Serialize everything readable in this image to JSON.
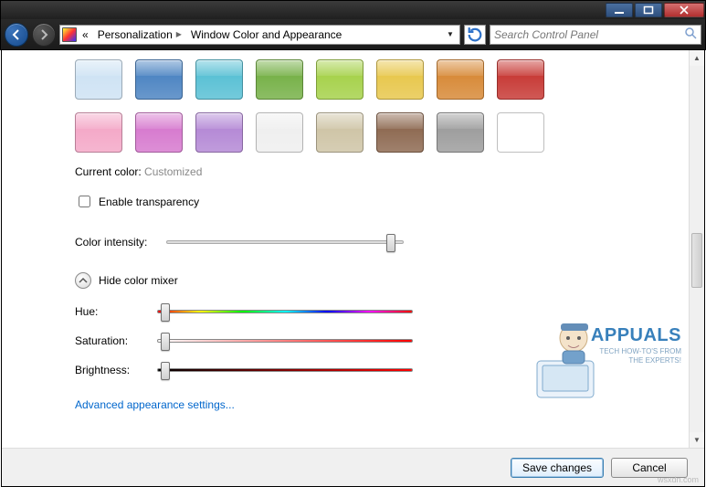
{
  "window": {
    "min_tooltip": "Minimize",
    "max_tooltip": "Maximize",
    "close_tooltip": "Close"
  },
  "nav": {
    "back_tooltip": "Back",
    "forward_tooltip": "Forward",
    "crumb_prefix_glyph": "«",
    "crumb1": "Personalization",
    "crumb2": "Window Color and Appearance",
    "refresh_tooltip": "Refresh",
    "search_placeholder": "Search Control Panel"
  },
  "swatches_row1": [
    "#cfe3f4",
    "#4f86c3",
    "#5bc1d5",
    "#78b24a",
    "#a7d24d",
    "#e8c84f",
    "#d88b3a",
    "#c83c38"
  ],
  "swatches_row2": [
    "#f4a9c8",
    "#d77bcf",
    "#b58ad6",
    "#efefef",
    "#cfc5a7",
    "#8f6b53",
    "#9e9e9e",
    "#ffffff"
  ],
  "current_color_label": "Current color:",
  "current_color_value": "Customized",
  "transparency_label": "Enable transparency",
  "transparency_checked": false,
  "intensity_label": "Color intensity:",
  "intensity_pct": 96,
  "expander_label": "Hide color mixer",
  "mixer": {
    "hue_label": "Hue:",
    "hue_pct": 1,
    "sat_label": "Saturation:",
    "sat_pct": 1,
    "bri_label": "Brightness:",
    "bri_pct": 1
  },
  "link_label": "Advanced appearance settings...",
  "footer": {
    "save_label": "Save changes",
    "cancel_label": "Cancel"
  },
  "watermark": {
    "brand": "APPUALS",
    "tagline1": "TECH HOW-TO'S FROM",
    "tagline2": "THE EXPERTS!"
  },
  "source_note": "wsxdn.com"
}
